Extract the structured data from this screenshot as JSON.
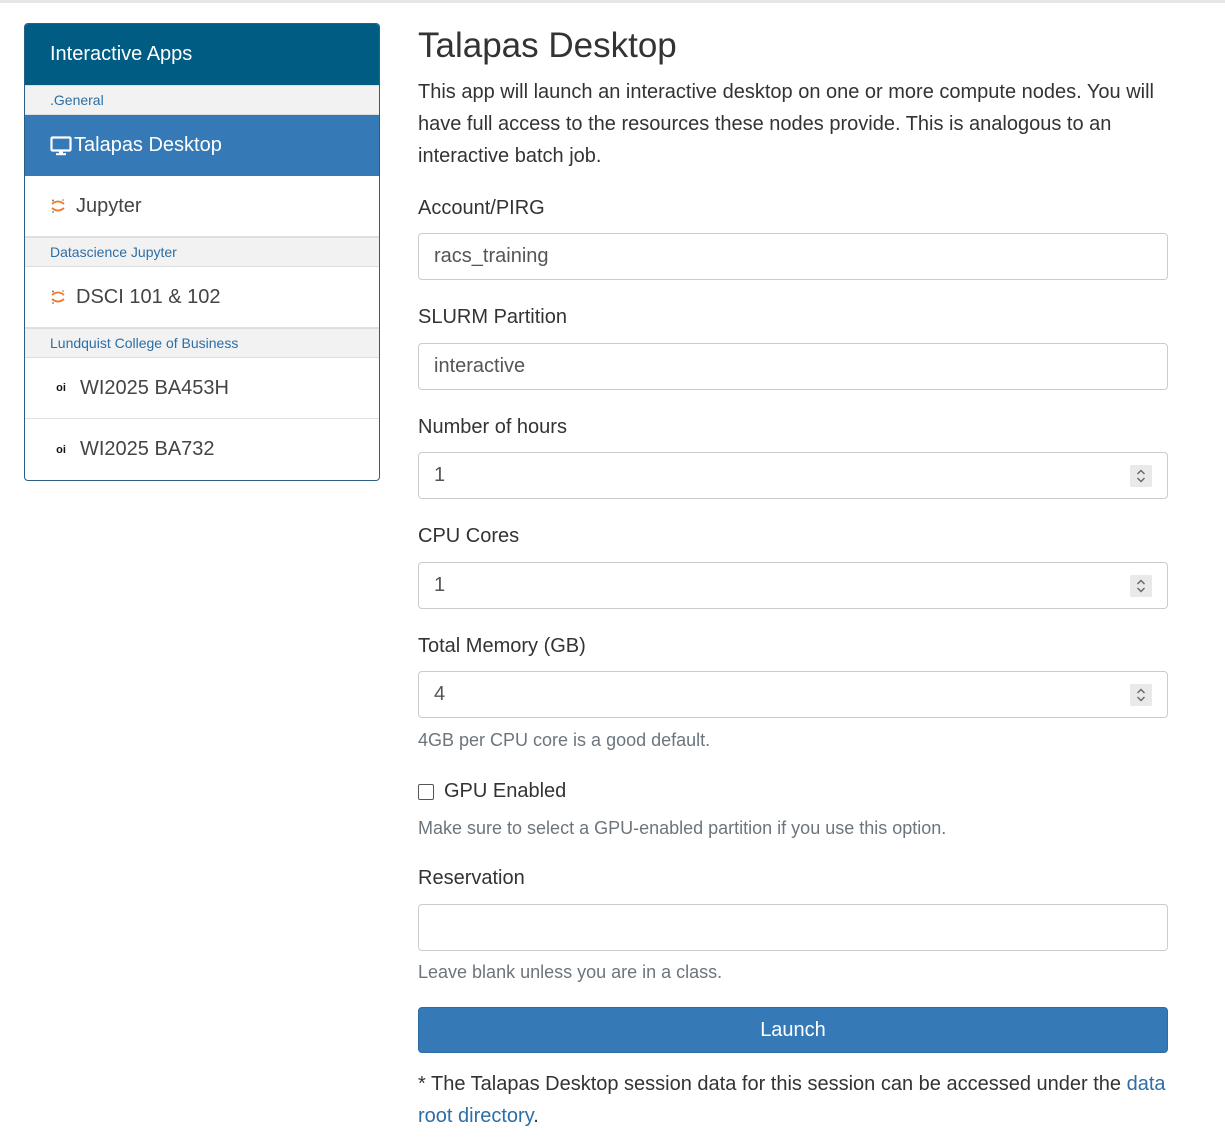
{
  "sidebar": {
    "header": "Interactive Apps",
    "groups": [
      {
        "name": ".General",
        "items": [
          {
            "label": "Talapas Desktop",
            "icon": "desktop-icon",
            "active": true
          },
          {
            "label": "Jupyter",
            "icon": "jupyter-icon",
            "active": false
          }
        ]
      },
      {
        "name": "Datascience Jupyter",
        "items": [
          {
            "label": "DSCI 101 & 102",
            "icon": "jupyter-icon",
            "active": false
          }
        ]
      },
      {
        "name": "Lundquist College of Business",
        "items": [
          {
            "label": "WI2025 BA453H",
            "icon": "oi-icon",
            "icon_text": "oi",
            "active": false
          },
          {
            "label": "WI2025 BA732",
            "icon": "oi-icon",
            "icon_text": "oi",
            "active": false
          }
        ]
      }
    ]
  },
  "main": {
    "title": "Talapas Desktop",
    "description": "This app will launch an interactive desktop on one or more compute nodes. You will have full access to the resources these nodes provide. This is analogous to an interactive batch job.",
    "fields": {
      "account": {
        "label": "Account/PIRG",
        "value": "racs_training"
      },
      "partition": {
        "label": "SLURM Partition",
        "value": "interactive"
      },
      "hours": {
        "label": "Number of hours",
        "value": "1"
      },
      "cores": {
        "label": "CPU Cores",
        "value": "1"
      },
      "memory": {
        "label": "Total Memory (GB)",
        "value": "4",
        "help": "4GB per CPU core is a good default."
      },
      "gpu": {
        "label": "GPU Enabled",
        "checked": false,
        "help": "Make sure to select a GPU-enabled partition if you use this option."
      },
      "reservation": {
        "label": "Reservation",
        "value": "",
        "help": "Leave blank unless you are in a class."
      }
    },
    "launch_label": "Launch",
    "footnote": {
      "text": "* The Talapas Desktop session data for this session can be accessed under the ",
      "link_text": "data root directory",
      "suffix": "."
    }
  },
  "colors": {
    "sidebar_header": "#005c83",
    "active_item": "#3579b6",
    "link": "#2c6ea6",
    "button": "#3579b6"
  }
}
